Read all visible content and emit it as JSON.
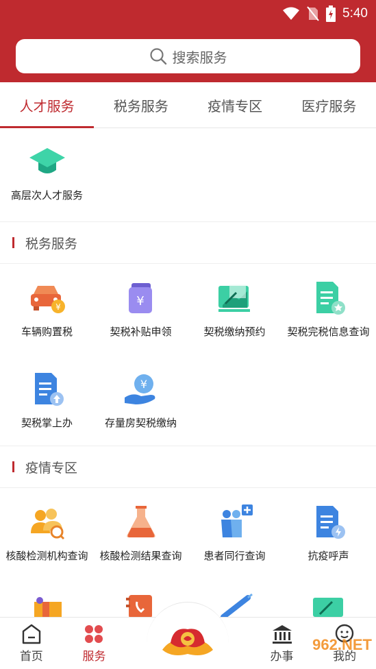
{
  "status": {
    "time": "5:40"
  },
  "search": {
    "placeholder": "搜索服务"
  },
  "tabs": [
    {
      "label": "人才服务",
      "active": true
    },
    {
      "label": "税务服务",
      "active": false
    },
    {
      "label": "疫情专区",
      "active": false
    },
    {
      "label": "医疗服务",
      "active": false
    }
  ],
  "talent": {
    "items": [
      {
        "label": "高层次人才服务",
        "icon": "graduation-cap-icon"
      }
    ]
  },
  "tax": {
    "title": "税务服务",
    "items": [
      {
        "label": "车辆购置税",
        "icon": "car-tax-icon"
      },
      {
        "label": "契税补贴申领",
        "icon": "wallet-yen-icon"
      },
      {
        "label": "契税缴纳预约",
        "icon": "appointment-icon"
      },
      {
        "label": "契税完税信息查询",
        "icon": "document-query-icon"
      },
      {
        "label": "契税掌上办",
        "icon": "document-upload-icon"
      },
      {
        "label": "存量房契税缴纳",
        "icon": "hand-coin-icon"
      }
    ]
  },
  "epidemic": {
    "title": "疫情专区",
    "items": [
      {
        "label": "核酸检测机构查询",
        "icon": "people-search-icon"
      },
      {
        "label": "核酸检测结果查询",
        "icon": "flask-icon"
      },
      {
        "label": "患者同行查询",
        "icon": "patients-plus-icon"
      },
      {
        "label": "抗疫呼声",
        "icon": "document-voice-icon"
      }
    ]
  },
  "bottom_nav": [
    {
      "label": "首页",
      "icon": "home-icon",
      "active": false
    },
    {
      "label": "服务",
      "icon": "grid-icon",
      "active": true
    },
    {
      "label": "办事",
      "icon": "bank-icon",
      "active": false
    },
    {
      "label": "我的",
      "icon": "face-icon",
      "active": false
    }
  ],
  "watermark": "962.NET",
  "colors": {
    "brand": "#bf2a2f"
  }
}
